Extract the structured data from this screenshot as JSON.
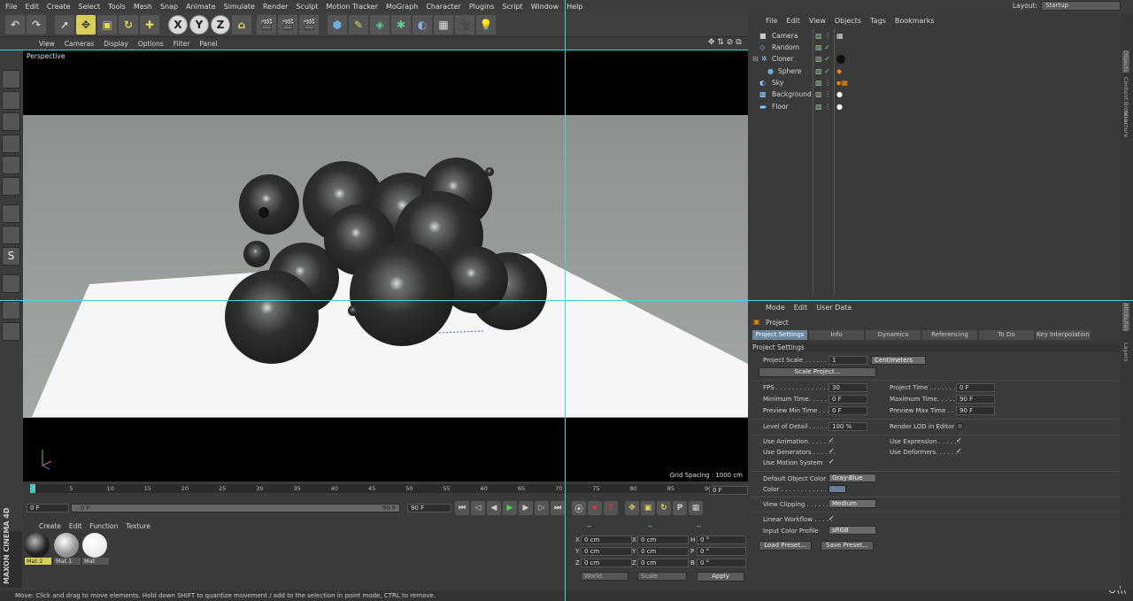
{
  "menubar": {
    "items": [
      "File",
      "Edit",
      "Create",
      "Select",
      "Tools",
      "Mesh",
      "Snap",
      "Animate",
      "Simulate",
      "Render",
      "Sculpt",
      "Motion Tracker",
      "MoGraph",
      "Character",
      "Plugins",
      "Script",
      "Window",
      "Help"
    ],
    "layout_label": "Layout:",
    "layout_value": "Startup"
  },
  "toolbar": {
    "axis_x": "X",
    "axis_y": "Y",
    "axis_z": "Z"
  },
  "viewport": {
    "menu": [
      "View",
      "Cameras",
      "Display",
      "Options",
      "Filter",
      "Panel"
    ],
    "label": "Perspective",
    "grid": "Grid Spacing : 1000 cm"
  },
  "timeline": {
    "ticks": [
      "0",
      "5",
      "10",
      "15",
      "20",
      "25",
      "30",
      "35",
      "40",
      "45",
      "50",
      "55",
      "60",
      "65",
      "70",
      "75",
      "80",
      "85",
      "90"
    ],
    "end_frame": "0 F",
    "start_field": "0 F",
    "slider_left": "0 F",
    "slider_right": "90 F",
    "max_field": "90 F"
  },
  "materials": {
    "menu": [
      "Create",
      "Edit",
      "Function",
      "Texture"
    ],
    "items": [
      {
        "label": "Mat.2"
      },
      {
        "label": "Mat.1"
      },
      {
        "label": "Mat"
      }
    ]
  },
  "brand": {
    "line1": "MAXON",
    "line2": "CINEMA 4D"
  },
  "coords": {
    "col1": "--",
    "col2": "--",
    "col3": "--",
    "rows": [
      {
        "a": "X",
        "av": "0 cm",
        "b": "X",
        "bv": "0 cm",
        "c": "H",
        "cv": "0 °"
      },
      {
        "a": "Y",
        "av": "0 cm",
        "b": "Y",
        "bv": "0 cm",
        "c": "P",
        "cv": "0 °"
      },
      {
        "a": "Z",
        "av": "0 cm",
        "b": "Z",
        "bv": "0 cm",
        "c": "B",
        "cv": "0 °"
      }
    ],
    "world": "World",
    "scale": "Scale",
    "apply": "Apply"
  },
  "objects": {
    "menu": [
      "File",
      "Edit",
      "View",
      "Objects",
      "Tags",
      "Bookmarks"
    ],
    "items": [
      {
        "name": "Camera"
      },
      {
        "name": "Random"
      },
      {
        "name": "Cloner"
      },
      {
        "name": "Sphere"
      },
      {
        "name": "Sky"
      },
      {
        "name": "Background"
      },
      {
        "name": "Floor"
      }
    ]
  },
  "side_tabs": {
    "top": [
      "Objects",
      "Content Browser",
      "Structure"
    ],
    "bottom": [
      "Attributes",
      "Layers"
    ]
  },
  "attributes": {
    "menu": [
      "Mode",
      "Edit",
      "User Data"
    ],
    "title": "Project",
    "tabs": [
      "Project Settings",
      "Info",
      "Dynamics",
      "Referencing",
      "To Do",
      "Key Interpolation"
    ],
    "section": "Project Settings",
    "project_scale_label": "Project Scale . . . . . .",
    "project_scale_value": "1",
    "project_scale_unit": "Centimeters",
    "scale_project_btn": "Scale Project...",
    "fps_label": "FPS . . . . . . . . . . . . . .",
    "fps": "30",
    "project_time_label": "Project Time . . . . . . . .",
    "project_time": "0 F",
    "min_time_label": "Minimum Time. . . . . .",
    "min_time": "0 F",
    "max_time_label": "Maximum Time. . . . . .",
    "max_time": "90 F",
    "prev_min_label": "Preview Min Time . . .",
    "prev_min": "0 F",
    "prev_max_label": "Preview Max Time . .",
    "prev_max": "90 F",
    "lod_label": "Level of Detail . . . . .",
    "lod": "100 %",
    "render_lod_label": "Render LOD in Editor",
    "use_anim": "Use Animation. . . . . . .",
    "use_expr": "Use Expression . . . . . .",
    "use_gen": "Use Generators . . . . . .",
    "use_def": "Use Deformers. . . . . . .",
    "use_motion": "Use Motion System",
    "def_color_label": "Default Object Color",
    "def_color": "Gray-Blue",
    "color_label": "Color . . . . . . . . . . . .",
    "view_clip_label": "View Clipping . . . . . .",
    "view_clip": "Medium",
    "linear_label": "Linear Workflow . . . . .",
    "input_profile_label": "Input Color Profile",
    "input_profile": "sRGB",
    "load_preset": "Load Preset...",
    "save_preset": "Save Preset..."
  },
  "status": "Move: Click and drag to move elements. Hold down SHIFT to quantize movement / add to the selection in point mode, CTRL to remove.",
  "colors": {
    "guide": "#45d4d4",
    "tab_active": "#6a86a0",
    "swatch": "#6b7f94"
  }
}
